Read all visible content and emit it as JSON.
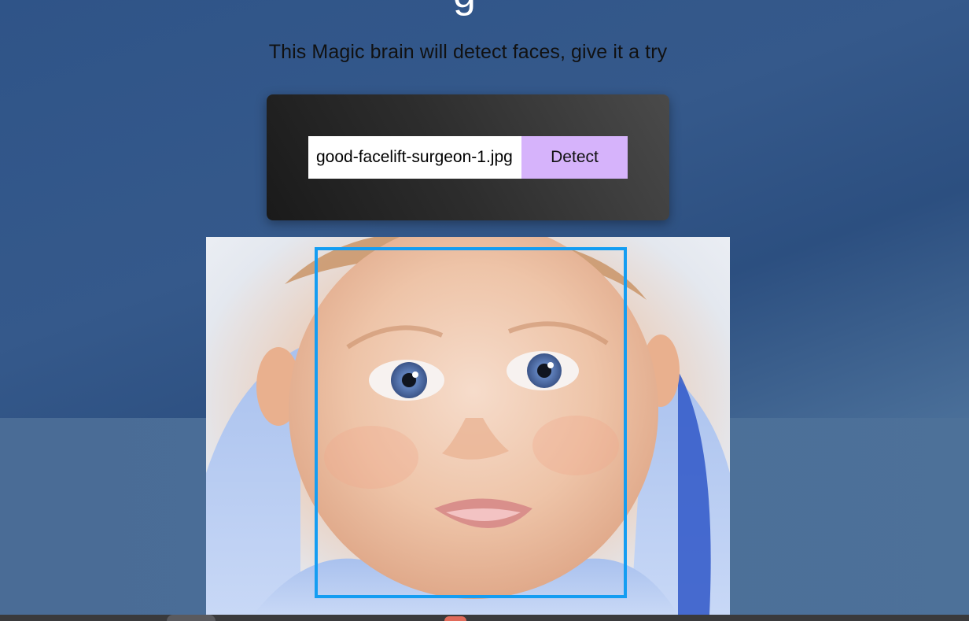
{
  "header": {
    "title_fragment": "g",
    "subtitle": "This Magic brain will detect faces, give it a try"
  },
  "form": {
    "input_value": "good-facelift-surgeon-1.jpg",
    "detect_label": "Detect"
  },
  "colors": {
    "accent_button": "#d6b3fb",
    "face_box": "#149df2"
  }
}
